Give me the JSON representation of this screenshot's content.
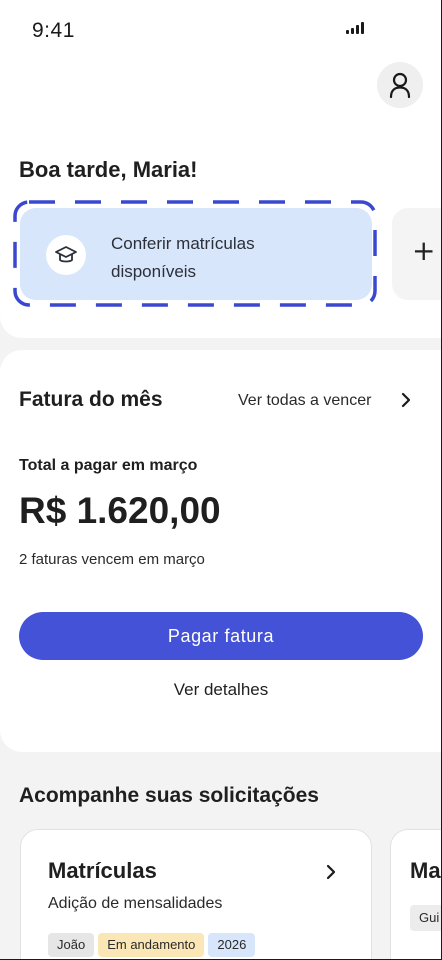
{
  "status_bar": {
    "time": "9:41"
  },
  "header": {
    "avatar_icon": "user-icon"
  },
  "greeting": "Boa tarde, Maria!",
  "quick_actions": [
    {
      "label": "Conferir matrículas disponíveis",
      "icon": "graduation-cap-icon",
      "highlighted": true
    },
    {
      "label": "+",
      "icon": "plus-icon"
    }
  ],
  "invoice": {
    "title": "Fatura do mês",
    "view_all_label": "Ver todas a vencer",
    "total_label": "Total a pagar em março",
    "total_amount": "R$ 1.620,00",
    "due_note": "2 faturas vencem em março",
    "pay_button_label": "Pagar fatura",
    "details_label": "Ver detalhes"
  },
  "requests": {
    "title": "Acompanhe suas solicitações",
    "cards": [
      {
        "title": "Matrículas",
        "subtitle": "Adição de mensalidades",
        "tags": [
          {
            "label": "João",
            "color": "#e6e6e6"
          },
          {
            "label": "Em andamento",
            "color": "#fbe7b5"
          },
          {
            "label": "2026",
            "color": "#d7e6fb"
          }
        ]
      },
      {
        "title": "Ma",
        "tag": "Gui"
      }
    ]
  },
  "colors": {
    "primary": "#4352d6",
    "highlight": "#d7e6fb",
    "dash": "#3a48d0"
  }
}
